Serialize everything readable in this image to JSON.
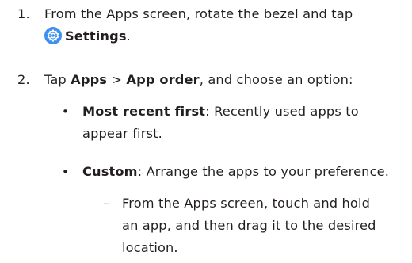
{
  "steps": [
    {
      "number": "1.",
      "text_before": "From the Apps screen, rotate the bezel and tap",
      "icon": "settings-gear-icon",
      "link": "Settings",
      "text_after": "."
    },
    {
      "number": "2.",
      "text_before": "Tap ",
      "apps": "Apps",
      "sep": " > ",
      "app_order": "App order",
      "text_after": ", and choose an option:"
    }
  ],
  "options": [
    {
      "bullet": "•",
      "label": "Most recent first",
      "desc_l1": ": Recently used apps to",
      "desc_l2": "appear first."
    },
    {
      "bullet": "•",
      "label": "Custom",
      "desc": ": Arrange the apps to your preference."
    }
  ],
  "sub": {
    "dash": "–",
    "line1": "From the Apps screen, touch and hold",
    "line2": "an app, and then drag it to the desired",
    "line3": "location."
  },
  "colors": {
    "text": "#231f20",
    "icon": "#3d8ff0"
  }
}
